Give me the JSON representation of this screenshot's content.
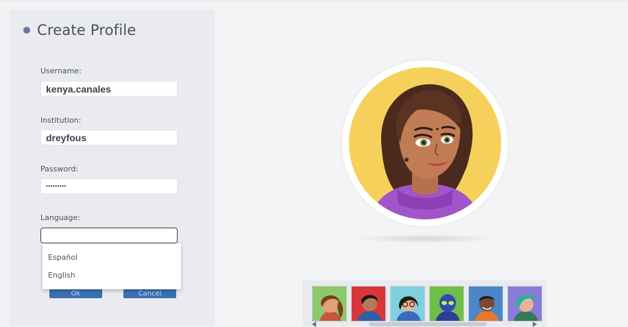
{
  "window": {
    "title": "Create Profile"
  },
  "form": {
    "username_label": "Username:",
    "username_value": "kenya.canales",
    "institution_label": "Institution:",
    "institution_value": "dreyfous",
    "password_label": "Password:",
    "password_value": "•••••••••",
    "language_label": "Language:",
    "language_value": "",
    "ok_label": "Ok",
    "cancel_label": "Cancel"
  },
  "language_dropdown": {
    "options": [
      "Español",
      "English"
    ]
  },
  "avatar": {
    "selected": "avatar-woman-purple-hoodie",
    "thumbnails": [
      {
        "name": "avatar-thumb-girl-brown-hair",
        "bg": "#8bc96a"
      },
      {
        "name": "avatar-thumb-man-red-bg",
        "bg": "#d9363b"
      },
      {
        "name": "avatar-thumb-woman-glasses",
        "bg": "#7fd0e0"
      },
      {
        "name": "avatar-thumb-robot-alien",
        "bg": "#6dbf47"
      },
      {
        "name": "avatar-thumb-boy-orange-shirt",
        "bg": "#4b86c9"
      },
      {
        "name": "avatar-thumb-teal-hair",
        "bg": "#8b7bd8"
      }
    ]
  },
  "colors": {
    "accent": "#3a6fb4",
    "title_dot": "#6a76a8",
    "avatar_bg": "#f5d15c"
  }
}
